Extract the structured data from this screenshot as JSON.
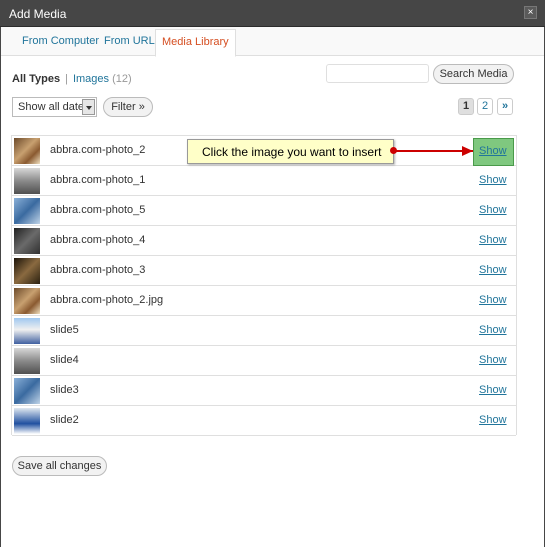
{
  "window": {
    "title": "Add Media",
    "close_label": "×"
  },
  "tabs": [
    {
      "label": "From Computer"
    },
    {
      "label": "From URL"
    },
    {
      "label": "Media Library"
    }
  ],
  "filters": {
    "all_types": "All Types",
    "separator": "|",
    "images_label": "Images",
    "images_count": "(12)"
  },
  "search": {
    "value": "",
    "button_label": "Search Media"
  },
  "date_filter": {
    "selected": "Show all dates",
    "filter_button": "Filter »"
  },
  "pagination": {
    "page1": "1",
    "page2": "2",
    "next": "»"
  },
  "media": [
    {
      "name": "abbra.com-photo_2",
      "show": "Show",
      "thumb": "brown"
    },
    {
      "name": "abbra.com-photo_1",
      "show": "Show",
      "thumb": "street"
    },
    {
      "name": "abbra.com-photo_5",
      "show": "Show",
      "thumb": "blue"
    },
    {
      "name": "abbra.com-photo_4",
      "show": "Show",
      "thumb": "dark"
    },
    {
      "name": "abbra.com-photo_3",
      "show": "Show",
      "thumb": "dark-brown"
    },
    {
      "name": "abbra.com-photo_2.jpg",
      "show": "Show",
      "thumb": "brown"
    },
    {
      "name": "slide5",
      "show": "Show",
      "thumb": "building"
    },
    {
      "name": "slide4",
      "show": "Show",
      "thumb": "street"
    },
    {
      "name": "slide3",
      "show": "Show",
      "thumb": "blue"
    },
    {
      "name": "slide2",
      "show": "Show",
      "thumb": "sign"
    }
  ],
  "callout": {
    "text": "Click the image you want to insert"
  },
  "footer": {
    "save_label": "Save all changes"
  },
  "colors": {
    "link": "#21759b",
    "active_tab": "#d54e21",
    "highlight": "#7fc87f",
    "callout_bg": "#ffffc8",
    "arrow": "#cc0000"
  }
}
